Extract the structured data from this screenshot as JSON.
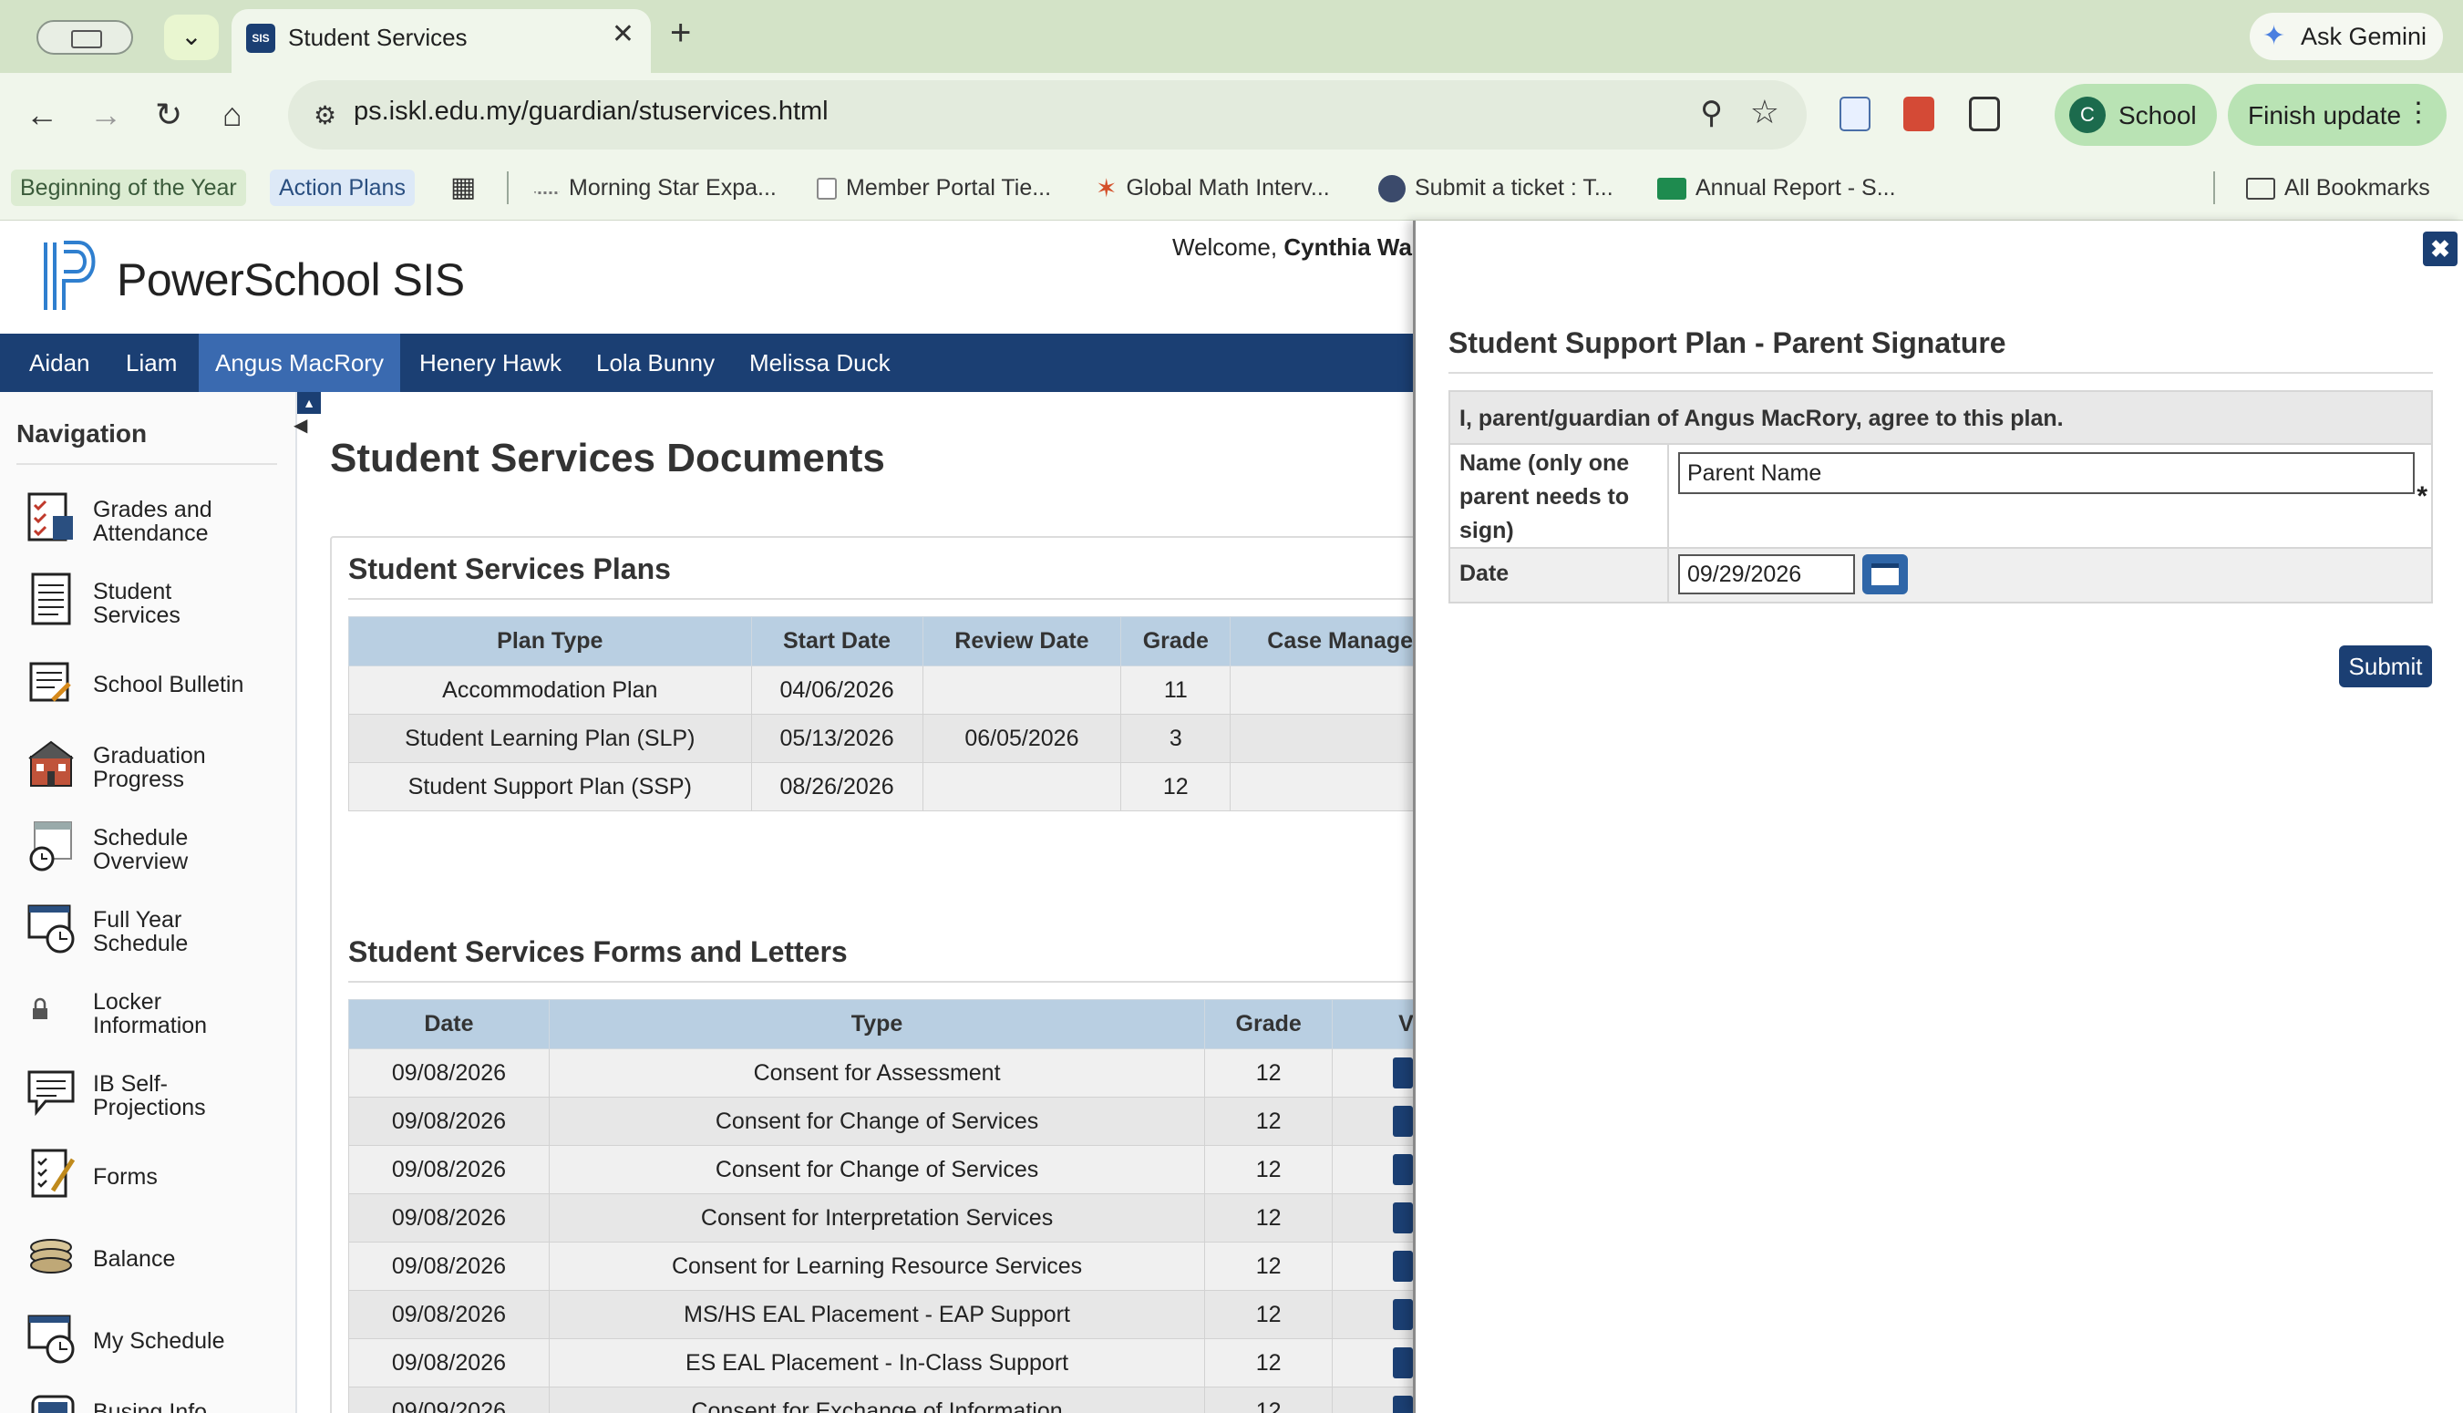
{
  "browser": {
    "tab_title": "Student Services",
    "tab_favicon": "SIS",
    "url": "ps.iskl.edu.my/guardian/stuservices.html",
    "gemini_label": "Ask Gemini",
    "profile_initial": "C",
    "profile_label": "School",
    "finish_label": "Finish update",
    "bookmarks": [
      "Beginning of the Year",
      "Action Plans",
      "Morning Star Expa...",
      "Member Portal Tie...",
      "Global Math Interv...",
      "Submit a ticket : T...",
      "Annual Report - S..."
    ],
    "all_bookmarks": "All Bookmarks"
  },
  "header": {
    "brand": "PowerSchool SIS",
    "welcome_prefix": "Welcome, ",
    "welcome_name": "Cynthia War"
  },
  "students": [
    "Aidan",
    "Liam",
    "Angus MacRory",
    "Henery Hawk",
    "Lola Bunny",
    "Melissa Duck"
  ],
  "active_student": "Angus MacRory",
  "sidebar": {
    "heading": "Navigation",
    "items": [
      {
        "line1": "Grades and",
        "line2": "Attendance",
        "icon": "grades-attendance-icon"
      },
      {
        "line1": "Student",
        "line2": "Services",
        "icon": "document-icon"
      },
      {
        "line1": "School Bulletin",
        "line2": "",
        "icon": "bulletin-icon"
      },
      {
        "line1": "Graduation",
        "line2": "Progress",
        "icon": "school-building-icon"
      },
      {
        "line1": "Schedule",
        "line2": "Overview",
        "icon": "calendar-clock-icon"
      },
      {
        "line1": "Full Year",
        "line2": "Schedule",
        "icon": "clock-schedule-icon"
      },
      {
        "line1": "Locker",
        "line2": "Information",
        "icon": "lock-icon"
      },
      {
        "line1": "IB Self-",
        "line2": "Projections",
        "icon": "speech-bubble-icon"
      },
      {
        "line1": "Forms",
        "line2": "",
        "icon": "checklist-pencil-icon"
      },
      {
        "line1": "Balance",
        "line2": "",
        "icon": "coins-icon"
      },
      {
        "line1": "My Schedule",
        "line2": "",
        "icon": "clock-schedule-icon"
      },
      {
        "line1": "Busing Info",
        "line2": "",
        "icon": "bus-icon"
      }
    ]
  },
  "main": {
    "title": "Student Services Documents",
    "plans": {
      "heading": "Student Services Plans",
      "columns": [
        "Plan Type",
        "Start Date",
        "Review Date",
        "Grade",
        "Case Manage"
      ],
      "rows": [
        [
          "Accommodation Plan",
          "04/06/2026",
          "",
          "11",
          ""
        ],
        [
          "Student Learning Plan (SLP)",
          "05/13/2026",
          "06/05/2026",
          "3",
          ""
        ],
        [
          "Student Support Plan (SSP)",
          "08/26/2026",
          "",
          "12",
          ""
        ]
      ]
    },
    "forms": {
      "heading": "Student Services Forms and Letters",
      "columns": [
        "Date",
        "Type",
        "Grade",
        "V"
      ],
      "rows": [
        [
          "09/08/2026",
          "Consent for Assessment",
          "12"
        ],
        [
          "09/08/2026",
          "Consent for Change of Services",
          "12"
        ],
        [
          "09/08/2026",
          "Consent for Change of Services",
          "12"
        ],
        [
          "09/08/2026",
          "Consent for Interpretation Services",
          "12"
        ],
        [
          "09/08/2026",
          "Consent for Learning Resource Services",
          "12"
        ],
        [
          "09/08/2026",
          "MS/HS EAL Placement - EAP Support",
          "12"
        ],
        [
          "09/08/2026",
          "ES EAL Placement - In-Class Support",
          "12"
        ],
        [
          "09/09/2026",
          "Consent for Exchange of Information",
          "12"
        ]
      ]
    }
  },
  "drawer": {
    "close_icon": "close-icon",
    "title": "Student Support Plan - Parent Signature",
    "agreement": "I, parent/guardian of Angus MacRory, agree to this plan.",
    "name_label_lines": [
      "Name (only one",
      "parent needs to",
      "sign)"
    ],
    "name_value": "Parent Name",
    "required_mark": "*",
    "date_label": "Date",
    "date_value": "09/29/2026",
    "submit_label": "Submit"
  }
}
